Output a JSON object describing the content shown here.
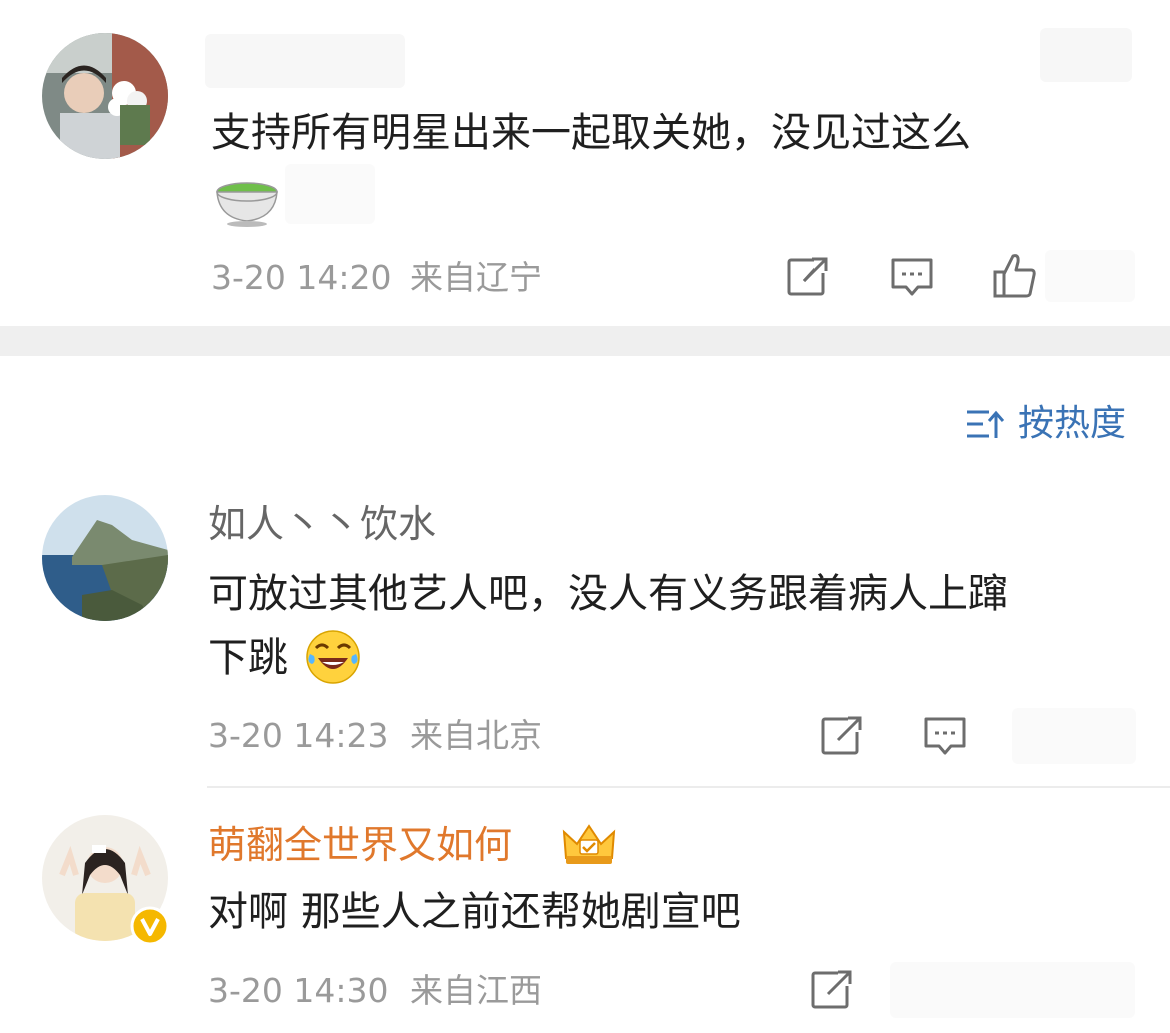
{
  "comments": [
    {
      "username": "",
      "text": "支持所有明星出来一起取关她，没见过这么",
      "time": "3-20 14:20",
      "location": "来自辽宁",
      "like_count": ""
    },
    {
      "username": "如人丶丶饮水",
      "text_line1": "可放过其他艺人吧，没人有义务跟着病人上蹿",
      "text_line2": "下跳",
      "time": "3-20 14:23",
      "location": "来自北京"
    },
    {
      "username": "萌翻全世界又如何",
      "text": "对啊 那些人之前还帮她剧宣吧",
      "time": "3-20 14:30",
      "location": "来自江西"
    }
  ],
  "sort": {
    "label": "按热度"
  },
  "icons": {
    "share": "share-icon",
    "comment": "comment-icon",
    "like": "thumbs-up-icon",
    "sort": "sort-icon",
    "tea": "tea-emoji",
    "laugh": "laugh-cry-emoji",
    "crown": "crown-badge-icon",
    "verified": "verified-v-icon"
  },
  "colors": {
    "vip_name": "#e0782c",
    "link": "#3a73b5",
    "verified": "#f5b800"
  }
}
